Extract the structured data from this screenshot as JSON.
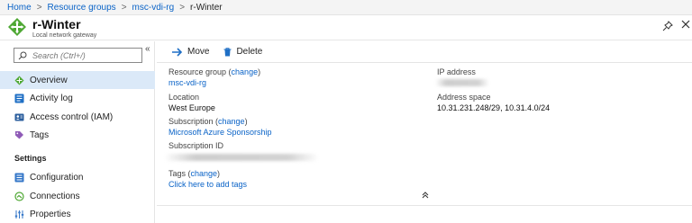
{
  "breadcrumb": {
    "home": "Home",
    "resource_groups": "Resource groups",
    "rg": "msc-vdi-rg",
    "current": "r-Winter",
    "separator": ">"
  },
  "header": {
    "title": "r-Winter",
    "subtitle": "Local network gateway"
  },
  "search": {
    "placeholder": "Search (Ctrl+/)"
  },
  "collapse_glyph": "«",
  "nav": {
    "overview": "Overview",
    "activity_log": "Activity log",
    "access_control": "Access control (IAM)",
    "tags": "Tags",
    "settings_section": "Settings",
    "configuration": "Configuration",
    "connections": "Connections",
    "properties": "Properties"
  },
  "toolbar": {
    "move": "Move",
    "delete": "Delete"
  },
  "essentials": {
    "resource_group_label": "Resource group",
    "change": "change",
    "resource_group_value": "msc-vdi-rg",
    "location_label": "Location",
    "location_value": "West Europe",
    "subscription_label": "Subscription",
    "subscription_value": "Microsoft Azure Sponsorship",
    "subscription_id_label": "Subscription ID",
    "ip_address_label": "IP address",
    "address_space_label": "Address space",
    "address_space_value": "10.31.231.248/29, 10.31.4.0/24",
    "tags_label": "Tags",
    "tags_value": "Click here to add tags"
  },
  "colors": {
    "link": "#0a63c7",
    "active_bg": "#dbe9f8",
    "accent_green": "#4fa834"
  },
  "icons": [
    "gateway-icon",
    "pin-icon",
    "close-icon",
    "search-icon",
    "overview-icon",
    "activity-log-icon",
    "iam-icon",
    "tag-icon",
    "configuration-icon",
    "connections-icon",
    "properties-icon",
    "move-arrow-icon",
    "delete-trash-icon",
    "collapse-up-icon"
  ]
}
